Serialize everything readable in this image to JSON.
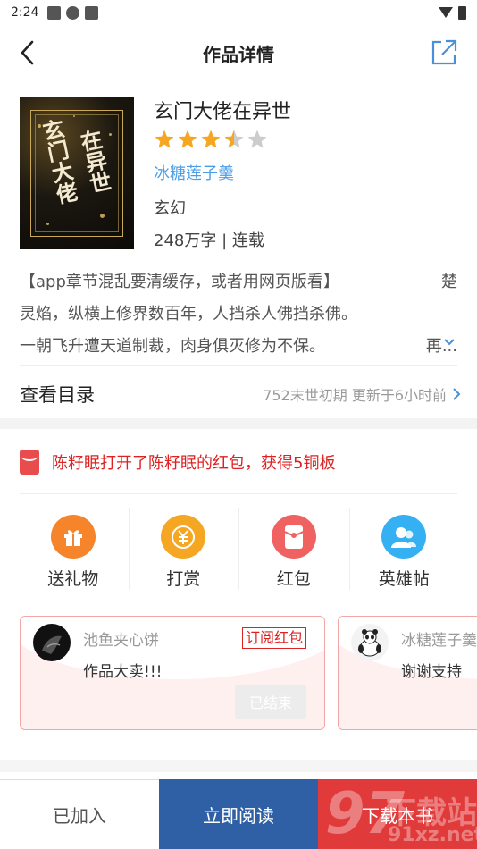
{
  "status_bar": {
    "time": "2:24"
  },
  "header": {
    "title": "作品详情"
  },
  "book": {
    "title": "玄门大佬在异世",
    "rating_stars": 3.5,
    "rating_max": 5,
    "author": "冰糖莲子羹",
    "genre": "玄幻",
    "meta": "248万字 | 连载",
    "cover_text_1": "玄门大佬",
    "cover_text_2": "在异世"
  },
  "description": {
    "line1_left": "【app章节混乱要清缓存，或者用网页版看】",
    "line1_right": "楚",
    "line2": "灵焰，纵横上修界数百年，人挡杀人佛挡杀佛。",
    "line3": "一朝飞升遭天道制裁，肉身俱灭修为不保。",
    "more_label": "再..."
  },
  "toc": {
    "label": "查看目录",
    "latest": "752末世初期  更新于6小时前"
  },
  "notice": {
    "text": "陈籽眠打开了陈籽眠的红包，获得5铜板"
  },
  "actions": [
    {
      "label": "送礼物",
      "icon": "gift-icon",
      "color": "#f5842a"
    },
    {
      "label": "打赏",
      "icon": "coin-icon",
      "color": "#f5a623"
    },
    {
      "label": "红包",
      "icon": "red-packet-icon",
      "color": "#f06262"
    },
    {
      "label": "英雄帖",
      "icon": "users-icon",
      "color": "#35b0f2"
    }
  ],
  "cards": [
    {
      "user": "池鱼夹心饼",
      "tag": "订阅红包",
      "message": "作品大卖!!!",
      "status": "已结束"
    },
    {
      "user": "冰糖莲子羹",
      "message": "谢谢支持"
    }
  ],
  "bottom_bar": {
    "added": "已加入",
    "read": "立即阅读",
    "download": "下载本书"
  },
  "watermark": {
    "big": "97",
    "a": "下载站",
    "b": "91xz.net"
  },
  "colors": {
    "accent_blue": "#2f5fa5",
    "download_red": "#e03a3a",
    "author_link": "#4a9ee8",
    "star": "#f5a623"
  }
}
